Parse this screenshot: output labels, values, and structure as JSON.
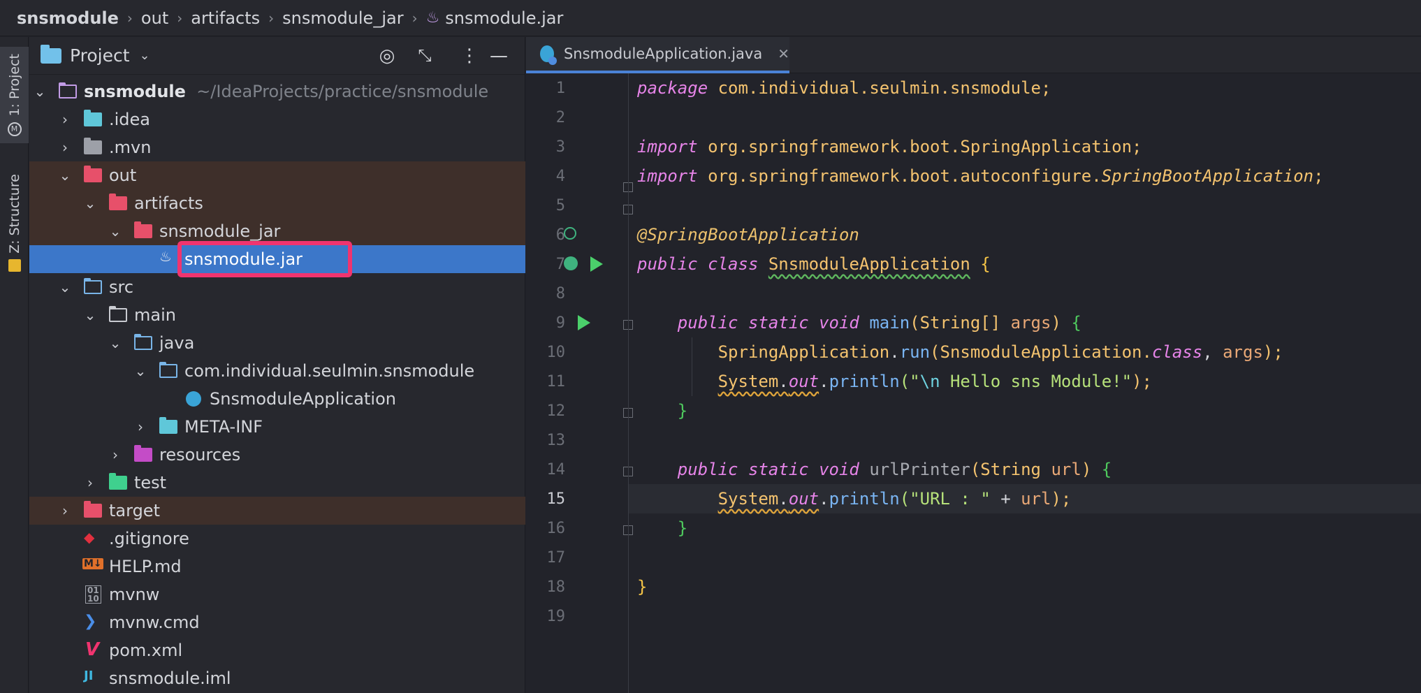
{
  "breadcrumb": [
    "snsmodule",
    "out",
    "artifacts",
    "snsmodule_jar",
    "snsmodule.jar"
  ],
  "tool_strip": {
    "project_tab": "1: Project",
    "structure_tab": "Z: Structure"
  },
  "project_panel": {
    "title": "Project",
    "tree": [
      {
        "label": "snsmodule",
        "hint": "~/IdeaProjects/practice/snsmodule"
      },
      {
        "label": ".idea"
      },
      {
        "label": ".mvn"
      },
      {
        "label": "out"
      },
      {
        "label": "artifacts"
      },
      {
        "label": "snsmodule_jar"
      },
      {
        "label": "snsmodule.jar"
      },
      {
        "label": "src"
      },
      {
        "label": "main"
      },
      {
        "label": "java"
      },
      {
        "label": "com.individual.seulmin.snsmodule"
      },
      {
        "label": "SnsmoduleApplication"
      },
      {
        "label": "META-INF"
      },
      {
        "label": "resources"
      },
      {
        "label": "test"
      },
      {
        "label": "target"
      },
      {
        "label": ".gitignore"
      },
      {
        "label": "HELP.md"
      },
      {
        "label": "mvnw"
      },
      {
        "label": "mvnw.cmd"
      },
      {
        "label": "pom.xml"
      },
      {
        "label": "snsmodule.iml"
      }
    ]
  },
  "editor": {
    "tab_title": "SnsmoduleApplication.java",
    "current_line": 15,
    "line_numbers": [
      "1",
      "2",
      "3",
      "4",
      "5",
      "6",
      "7",
      "8",
      "9",
      "10",
      "11",
      "12",
      "13",
      "14",
      "15",
      "16",
      "17",
      "18",
      "19"
    ],
    "code": {
      "l1": [
        "package",
        "com.individual.seulmin.snsmodule;"
      ],
      "l3": [
        "import",
        "org.springframework.boot.SpringApplication;"
      ],
      "l4": [
        "import",
        "org.springframework.boot.autoconfigure.",
        "SpringBootApplication",
        ";"
      ],
      "l6": [
        "@SpringBootApplication"
      ],
      "l7": [
        "public class",
        "SnsmoduleApplication",
        "{"
      ],
      "l9": [
        "public static void",
        "main",
        "(String[]",
        "args",
        ")",
        "{"
      ],
      "l10": [
        "SpringApplication",
        ".",
        "run",
        "(SnsmoduleApplication.",
        "class",
        ",",
        "args",
        ");"
      ],
      "l11": [
        "System",
        ".",
        "out",
        ".",
        "println",
        "(\"",
        "\\n",
        " Hello sns Module!\"",
        ");"
      ],
      "l12": [
        "}"
      ],
      "l14": [
        "public static void",
        "urlPrinter",
        "(String",
        "url",
        ")",
        "{"
      ],
      "l15": [
        "System",
        ".",
        "out",
        ".",
        "println",
        "(\"URL : \"",
        " + ",
        "url",
        ");"
      ],
      "l16": [
        "}"
      ],
      "l18": [
        "}"
      ]
    }
  },
  "colors": {
    "selection": "#3c77c9",
    "highlight_box": "#f0346f",
    "excluded_bg": "#3e2f2a",
    "tab_underline": "#4a82d6"
  }
}
